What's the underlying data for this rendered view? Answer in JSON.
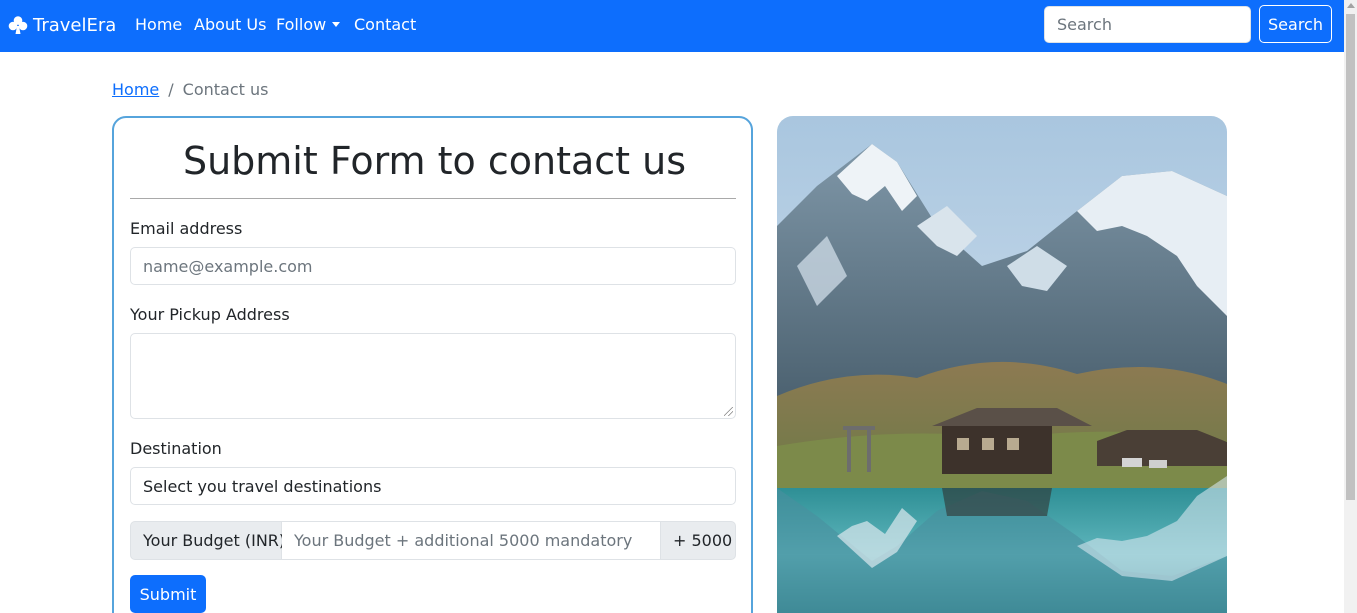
{
  "navbar": {
    "brand": "TravelEra",
    "brand_icon": "club-icon",
    "links": {
      "home": "Home",
      "about": "About Us",
      "follow": "Follow",
      "contact": "Contact"
    },
    "search_placeholder": "Search",
    "search_button": "Search",
    "color": "#0d6efd"
  },
  "breadcrumb": {
    "home": "Home",
    "separator": "/",
    "current": "Contact us"
  },
  "form": {
    "title": "Submit Form to contact us",
    "email_label": "Email address",
    "email_placeholder": "name@example.com",
    "pickup_label": "Your Pickup Address",
    "pickup_value": "",
    "destination_label": "Destination",
    "destination_selected": "Select you travel destinations",
    "budget_prefix": "Your Budget (INR)",
    "budget_placeholder": "Your Budget + additional 5000 mandatory",
    "budget_suffix": "+ 5000",
    "submit_label": "Submit",
    "border_color": "#56a4dc"
  },
  "image": {
    "subject": "snow-capped mountains, wooden chalet and turquoise alpine lake"
  }
}
